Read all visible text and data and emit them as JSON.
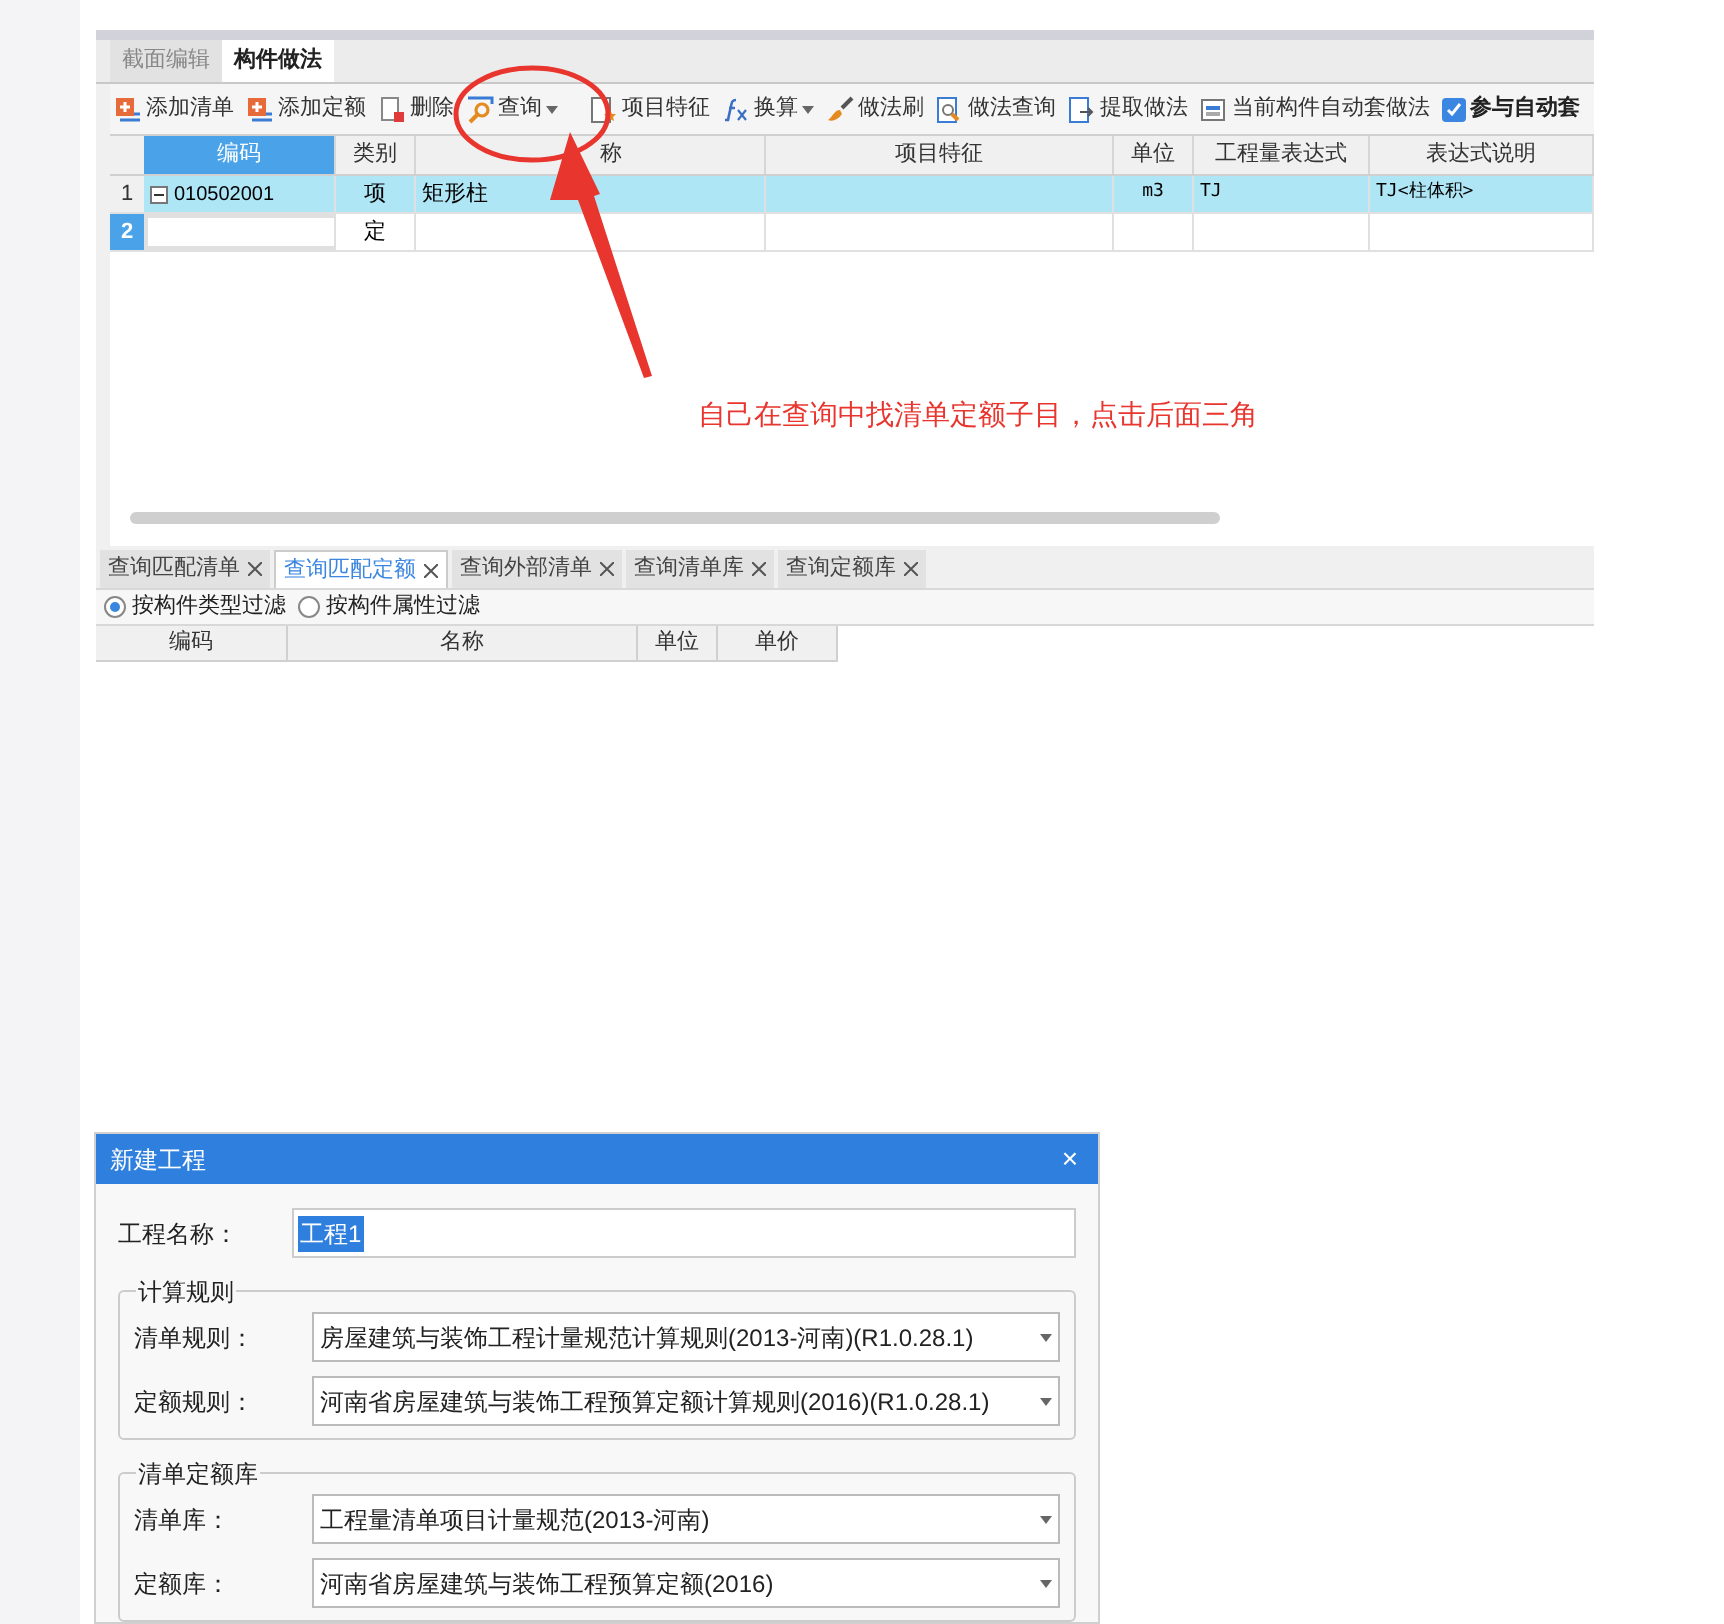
{
  "screen1": {
    "tabs": [
      {
        "label": "截面编辑",
        "selected": false
      },
      {
        "label": "构件做法",
        "selected": true
      }
    ],
    "toolbar": [
      {
        "label": "添加清单",
        "dropdown": false
      },
      {
        "label": "添加定额",
        "dropdown": false
      },
      {
        "label": "删除",
        "dropdown": false
      },
      {
        "label": "查询",
        "dropdown": true
      },
      {
        "label": "项目特征",
        "dropdown": false
      },
      {
        "label": "换算",
        "dropdown": true
      },
      {
        "label": "做法刷",
        "dropdown": false
      },
      {
        "label": "做法查询",
        "dropdown": false
      },
      {
        "label": "提取做法",
        "dropdown": false
      },
      {
        "label": "当前构件自动套做法",
        "dropdown": false
      }
    ],
    "auto_checkbox": {
      "label": "参与自动套",
      "checked": true
    },
    "table": {
      "columns": [
        "编码",
        "类别",
        "称",
        "项目特征",
        "单位",
        "工程量表达式",
        "表达式说明"
      ],
      "rows": [
        {
          "num": "1",
          "selected": true,
          "expanded": true,
          "cells": [
            "010502001",
            "项",
            "矩形柱",
            "",
            "m3",
            "TJ",
            "TJ<柱体积>"
          ]
        },
        {
          "num": "2",
          "selected": false,
          "cells": [
            "",
            "定",
            "",
            "",
            "",
            "",
            ""
          ]
        }
      ]
    },
    "annotation": "自己在查询中找清单定额子目，点击后面三角",
    "query_tabs": [
      {
        "label": "查询匹配清单",
        "selected": false
      },
      {
        "label": "查询匹配定额",
        "selected": true
      },
      {
        "label": "查询外部清单",
        "selected": false
      },
      {
        "label": "查询清单库",
        "selected": false
      },
      {
        "label": "查询定额库",
        "selected": false
      }
    ],
    "filters": [
      {
        "label": "按构件类型过滤",
        "selected": true
      },
      {
        "label": "按构件属性过滤",
        "selected": false
      }
    ],
    "query_columns": [
      "编码",
      "名称",
      "单位",
      "单价"
    ]
  },
  "dialog": {
    "title": "新建工程",
    "close": "×",
    "name_field": {
      "label": "工程名称：",
      "value": "工程1"
    },
    "groups": [
      {
        "title": "计算规则",
        "fields": [
          {
            "label": "清单规则：",
            "value": "房屋建筑与装饰工程计量规范计算规则(2013-河南)(R1.0.28.1)"
          },
          {
            "label": "定额规则：",
            "value": "河南省房屋建筑与装饰工程预算定额计算规则(2016)(R1.0.28.1)"
          }
        ]
      },
      {
        "title": "清单定额库",
        "fields": [
          {
            "label": "清单库：",
            "value": "工程量清单项目计量规范(2013-河南)"
          },
          {
            "label": "定额库：",
            "value": "河南省房屋建筑与装饰工程预算定额(2016)"
          }
        ]
      }
    ]
  }
}
